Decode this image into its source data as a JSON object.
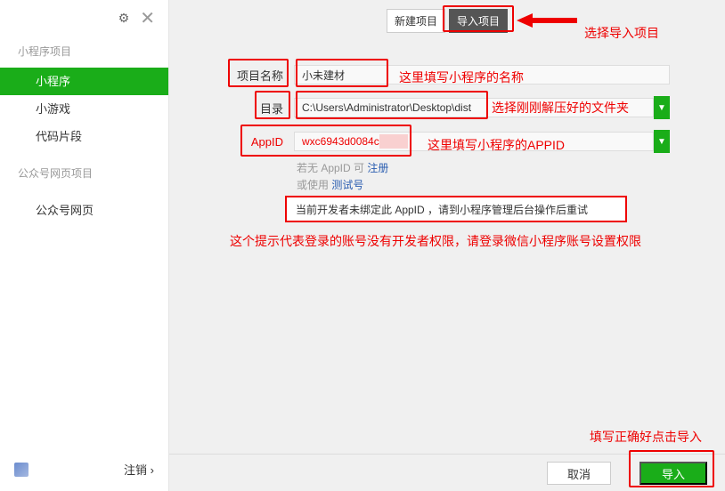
{
  "sidebar": {
    "section1_title": "小程序项目",
    "items": [
      {
        "label": "小程序",
        "active": true
      },
      {
        "label": "小游戏",
        "active": false
      },
      {
        "label": "代码片段",
        "active": false
      }
    ],
    "section2_title": "公众号网页项目",
    "items2": [
      {
        "label": "公众号网页",
        "active": false
      }
    ],
    "logout_label": "注销 ›"
  },
  "tabs": {
    "new_project": "新建项目",
    "import_project": "导入项目"
  },
  "form": {
    "project_name_label": "项目名称",
    "project_name_value": "小未建材",
    "directory_label": "目录",
    "directory_value": "C:\\Users\\Administrator\\Desktop\\dist",
    "appid_label": "AppID",
    "appid_value": "wxc6943d0084c"
  },
  "hints": {
    "no_appid_text": "若无 AppID 可",
    "register_link": "注册",
    "or_use_text": "或使用",
    "test_link": "测试号"
  },
  "warning": {
    "text": "当前开发者未绑定此 AppID ，请到小程序管理后台操作后重试"
  },
  "buttons": {
    "cancel": "取消",
    "import": "导入"
  },
  "annotations": {
    "select_import": "选择导入项目",
    "fill_name": "这里填写小程序的名称",
    "select_folder": "选择刚刚解压好的文件夹",
    "fill_appid": "这里填写小程序的APPID",
    "permission_hint": "这个提示代表登录的账号没有开发者权限，请登录微信小程序账号设置权限",
    "click_import": "填写正确好点击导入"
  },
  "colors": {
    "accent_green": "#1aad19",
    "annotation_red": "#e00000"
  }
}
